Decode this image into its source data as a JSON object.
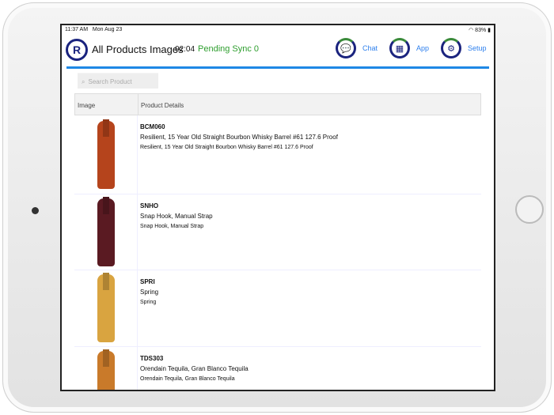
{
  "status": {
    "time": "11:37 AM",
    "date": "Mon Aug 23",
    "battery": "83%"
  },
  "header": {
    "logo": "R",
    "title": "All Products Images",
    "timer": "02:04",
    "pending": "Pending Sync 0",
    "nav": [
      {
        "label": "Chat",
        "icon": "chat-icon"
      },
      {
        "label": "App",
        "icon": "apps-grid-icon"
      },
      {
        "label": "Setup",
        "icon": "gear-icon"
      }
    ]
  },
  "search": {
    "placeholder": "Search Product"
  },
  "table": {
    "headers": [
      "Image",
      "Product Details"
    ],
    "rows": [
      {
        "code": "BCM060",
        "name": "Resilient, 15 Year Old Straight Bourbon Whisky Barrel #61 127.6 Proof",
        "desc": "Resilient, 15 Year Old Straight Bourbon Whisky Barrel #61 127.6 Proof",
        "color": "#b5441c"
      },
      {
        "code": "SNHO",
        "name": "Snap Hook, Manual Strap",
        "desc": "Snap Hook, Manual Strap",
        "color": "#5a1a22"
      },
      {
        "code": "SPRI",
        "name": "Spring",
        "desc": "Spring",
        "color": "#d9a440"
      },
      {
        "code": "TDS303",
        "name": "Orendain Tequila, Gran Blanco Tequila",
        "desc": "Orendain Tequila, Gran Blanco Tequila",
        "color": "#c97a2a"
      }
    ]
  }
}
